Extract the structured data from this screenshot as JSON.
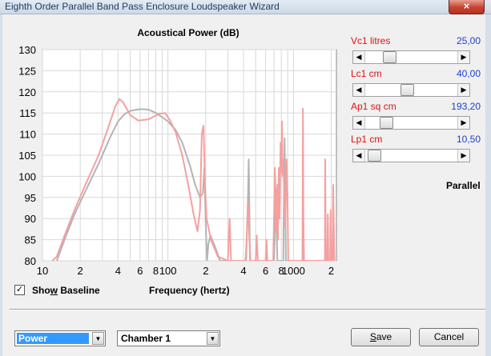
{
  "window": {
    "title": "Eighth Order Parallel Band Pass Enclosure Loudspeaker Wizard",
    "close_glyph": "×"
  },
  "chart": {
    "title": "Acoustical Power (dB)",
    "x_label": "Frequency (hertz)"
  },
  "chart_data": {
    "type": "line",
    "title": "Acoustical Power (dB)",
    "xlabel": "Frequency (hertz)",
    "ylabel": "",
    "xscale": "log",
    "xlim": [
      10,
      2200
    ],
    "ylim": [
      80,
      130
    ],
    "yticks": [
      80,
      85,
      90,
      95,
      100,
      105,
      110,
      115,
      120,
      125,
      130
    ],
    "xticks": [
      {
        "value": 10,
        "label": "10"
      },
      {
        "value": 20,
        "label": "2"
      },
      {
        "value": 40,
        "label": "4"
      },
      {
        "value": 60,
        "label": "6"
      },
      {
        "value": 80,
        "label": "8"
      },
      {
        "value": 100,
        "label": "100"
      },
      {
        "value": 200,
        "label": "2"
      },
      {
        "value": 400,
        "label": "4"
      },
      {
        "value": 600,
        "label": "6"
      },
      {
        "value": 800,
        "label": "8"
      },
      {
        "value": 1000,
        "label": "1000"
      },
      {
        "value": 2000,
        "label": "2"
      }
    ],
    "grid": true,
    "series": [
      {
        "color": "#b4b4b4",
        "points": [
          [
            13,
            80
          ],
          [
            15,
            85
          ],
          [
            18,
            91
          ],
          [
            22,
            96.5
          ],
          [
            28,
            103
          ],
          [
            35,
            109.5
          ],
          [
            40,
            113
          ],
          [
            45,
            114.7
          ],
          [
            50,
            115.5
          ],
          [
            60,
            115.9
          ],
          [
            70,
            115.8
          ],
          [
            80,
            115
          ],
          [
            90,
            114
          ],
          [
            100,
            113
          ],
          [
            115,
            111
          ],
          [
            130,
            108
          ],
          [
            150,
            102.5
          ],
          [
            165,
            98
          ],
          [
            180,
            95
          ],
          [
            190,
            96
          ],
          [
            195,
            102
          ],
          [
            200,
            89
          ],
          [
            205,
            80
          ],
          [
            210,
            84
          ],
          [
            218,
            86
          ],
          [
            240,
            83
          ],
          [
            260,
            80
          ],
          [
            420,
            80
          ],
          [
            435,
            96
          ],
          [
            440,
            104
          ],
          [
            445,
            93
          ],
          [
            450,
            80
          ],
          [
            700,
            80
          ],
          [
            715,
            88
          ],
          [
            725,
            97
          ],
          [
            735,
            88
          ],
          [
            745,
            80
          ],
          [
            830,
            80
          ],
          [
            840,
            96
          ],
          [
            850,
            109
          ],
          [
            860,
            96
          ],
          [
            870,
            80
          ],
          [
            2060,
            80
          ],
          [
            2080,
            92
          ],
          [
            2120,
            80
          ]
        ]
      },
      {
        "color": "#f5a0a0",
        "points": [
          [
            12,
            80
          ],
          [
            13,
            81
          ],
          [
            15,
            86
          ],
          [
            18,
            92
          ],
          [
            22,
            98
          ],
          [
            28,
            105
          ],
          [
            33,
            111
          ],
          [
            38,
            116.5
          ],
          [
            41,
            118.3
          ],
          [
            44,
            117.5
          ],
          [
            50,
            114.5
          ],
          [
            58,
            113.2
          ],
          [
            70,
            113.5
          ],
          [
            85,
            114.8
          ],
          [
            95,
            115
          ],
          [
            105,
            113
          ],
          [
            115,
            110.5
          ],
          [
            130,
            105
          ],
          [
            145,
            98
          ],
          [
            160,
            91
          ],
          [
            172,
            87
          ],
          [
            180,
            92
          ],
          [
            186,
            110
          ],
          [
            192,
            112
          ],
          [
            197,
            99
          ],
          [
            203,
            90
          ],
          [
            220,
            85
          ],
          [
            250,
            81
          ],
          [
            300,
            80
          ],
          [
            310,
            90
          ],
          [
            318,
            80
          ],
          [
            415,
            80
          ],
          [
            425,
            86
          ],
          [
            435,
            94
          ],
          [
            445,
            85
          ],
          [
            455,
            80
          ],
          [
            500,
            80
          ],
          [
            510,
            86
          ],
          [
            520,
            80
          ],
          [
            600,
            80
          ],
          [
            610,
            85
          ],
          [
            620,
            80
          ],
          [
            690,
            80
          ],
          [
            705,
            96
          ],
          [
            712,
            102
          ],
          [
            720,
            96
          ],
          [
            730,
            87
          ],
          [
            745,
            98
          ],
          [
            752,
            85
          ],
          [
            765,
            102
          ],
          [
            775,
            90
          ],
          [
            790,
            108
          ],
          [
            800,
            101
          ],
          [
            810,
            113
          ],
          [
            820,
            100
          ],
          [
            830,
            104
          ],
          [
            845,
            95
          ],
          [
            860,
            88
          ],
          [
            880,
            104
          ],
          [
            895,
            96
          ],
          [
            910,
            80
          ],
          [
            1180,
            80
          ],
          [
            1190,
            116
          ],
          [
            1200,
            90
          ],
          [
            1215,
            80
          ],
          [
            1780,
            80
          ],
          [
            1790,
            104
          ],
          [
            1800,
            94
          ],
          [
            1815,
            80
          ],
          [
            1860,
            80
          ],
          [
            1880,
            91
          ],
          [
            1900,
            80
          ],
          [
            1960,
            80
          ],
          [
            1980,
            92
          ],
          [
            2000,
            80
          ],
          [
            2050,
            80
          ],
          [
            2070,
            98
          ],
          [
            2090,
            91
          ],
          [
            2110,
            80
          ]
        ]
      }
    ]
  },
  "show_baseline": {
    "label_pre": "Sho",
    "label_key": "w",
    "label_post": " Baseline",
    "checked": true,
    "check_glyph": "✓"
  },
  "params": [
    {
      "name": "Vc1  litres",
      "value": "25,00",
      "position": 0.22
    },
    {
      "name": "Lc1  cm",
      "value": "40,00",
      "position": 0.45
    },
    {
      "name": "Ap1  sq cm",
      "value": "193,20",
      "position": 0.18
    },
    {
      "name": "Lp1  cm",
      "value": "10,50",
      "position": 0.03
    }
  ],
  "scroll_arrows": {
    "left": "◀",
    "right": "▶"
  },
  "mode_label": "Parallel",
  "dropdowns": {
    "view": {
      "value": "Power",
      "arrow": "▼"
    },
    "chamber": {
      "value": "Chamber 1",
      "arrow": "▼"
    }
  },
  "buttons": {
    "save": {
      "key": "S",
      "rest": "ave"
    },
    "cancel": {
      "label": "Cancel"
    }
  }
}
